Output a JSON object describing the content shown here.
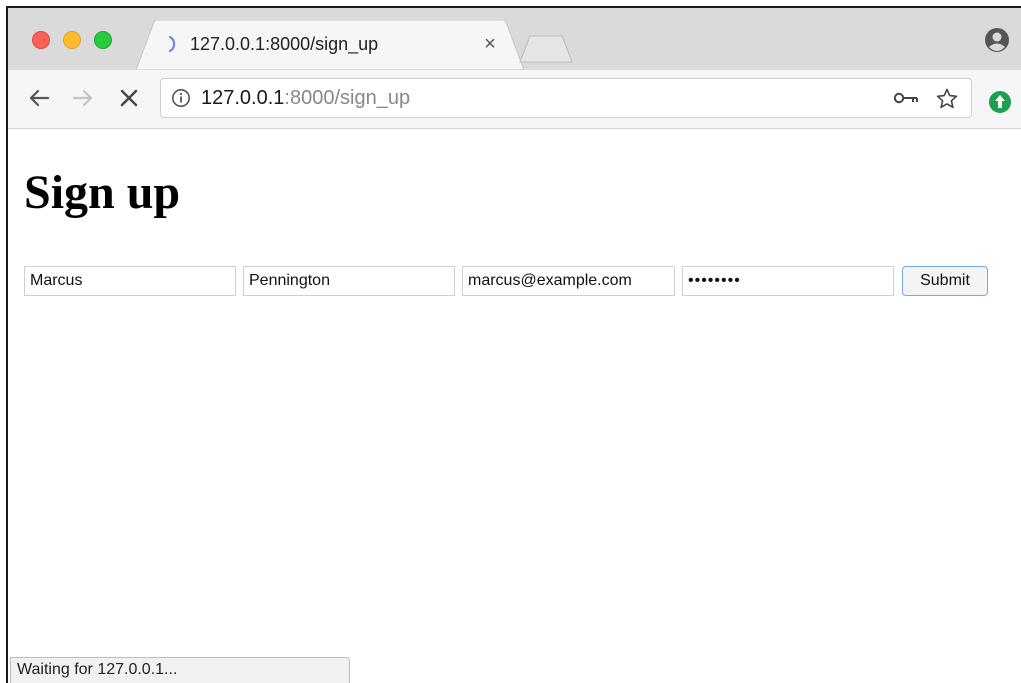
{
  "browser": {
    "tab": {
      "title": "127.0.0.1:8000/sign_up",
      "close_glyph": "×",
      "loading_icon": "spinner-icon"
    },
    "address_bar": {
      "host": "127.0.0.1",
      "path": ":8000/sign_up"
    },
    "icons": [
      "back-arrow-icon",
      "forward-arrow-icon",
      "stop-icon",
      "info-icon",
      "key-icon",
      "star-icon",
      "profile-icon",
      "extension-icon"
    ],
    "colors": {
      "close_button": "#fc5f57",
      "minimize_button": "#fdbc2e",
      "zoom_button": "#28c840",
      "extension_icon": "#1e9e4f"
    }
  },
  "page": {
    "title": "Sign up",
    "form": {
      "first_name": "Marcus",
      "last_name": "Pennington",
      "email": "marcus@example.com",
      "password": "••••••••",
      "submit_label": "Submit"
    }
  },
  "status": {
    "text": "Waiting for 127.0.0.1..."
  }
}
